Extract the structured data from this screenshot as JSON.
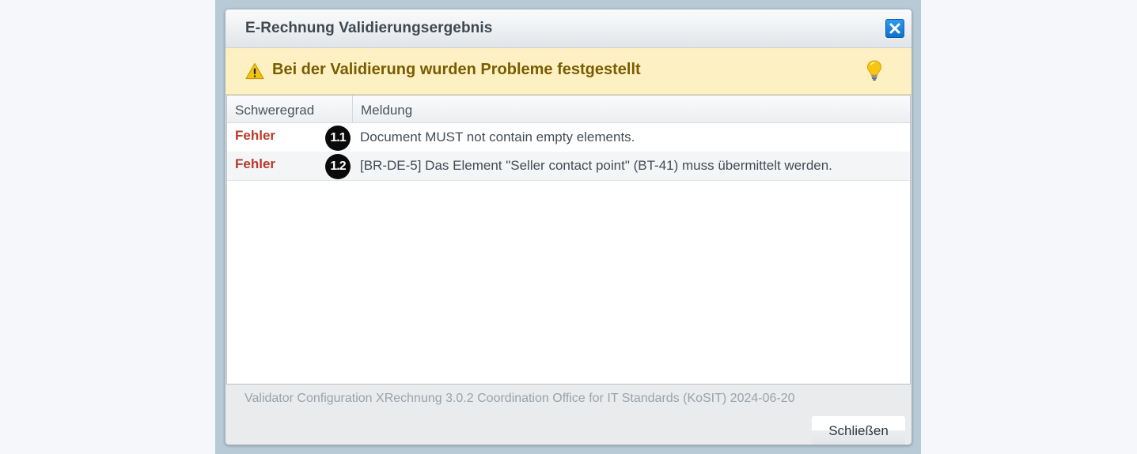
{
  "dialog": {
    "title": "E-Rechnung Validierungsergebnis",
    "banner_text": "Bei der Validierung wurden Probleme festgestellt",
    "columns": {
      "severity": "Schweregrad",
      "message": "Meldung"
    },
    "rows": [
      {
        "severity": "Fehler",
        "badge": "1.1",
        "message": "Document MUST not contain empty elements."
      },
      {
        "severity": "Fehler",
        "badge": "1.2",
        "message": "[BR-DE-5] Das Element \"Seller contact point\" (BT-41) muss übermittelt werden."
      }
    ],
    "footer_info": "Validator Configuration XRechnung 3.0.2 Coordination Office for IT Standards (KoSIT) 2024-06-20",
    "close_button_label": "Schließen"
  },
  "icons": {
    "close": "close-icon",
    "warning": "warning-icon",
    "hint": "lightbulb-icon"
  },
  "colors": {
    "banner_bg": "#fdf1c4",
    "banner_text": "#7a5c00",
    "error_text": "#b83a2c",
    "close_icon_bg": "#1a82dd"
  }
}
